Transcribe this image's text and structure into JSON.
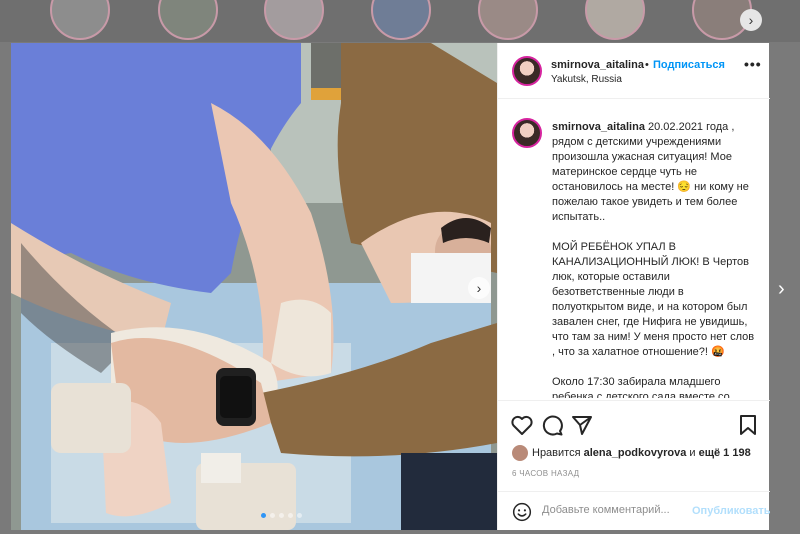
{
  "post": {
    "username": "smirnova_aitalina",
    "separator": "•",
    "follow_label": "Подписаться",
    "location": "Yakutsk, Russia",
    "more_label": "•••",
    "caption_username": "smirnova_aitalina",
    "caption_paragraphs": [
      "20.02.2021 года , рядом с детскими учреждениями произошла ужасная ситуация! Мое материнское сердце чуть не остановилось на месте! 😔 ни кому не пожелаю такое увидеть и тем более испытать..",
      "МОЙ РЕБЁНОК УПАЛ В КАНАЛИЗАЦИОННЫЙ ЛЮК! В Чертов люк, которые оставили безответственные люди в полуоткрытом виде, и на котором был завален снег, где Нифига не увидишь, что там за ним! У меня просто нет слов , что за халатное отношение?! 🤬",
      "Около 17:30 забирала младшего ребенка с детского сада вместе со"
    ],
    "likes_prefix": "Нравится",
    "likes_user": "alena_podkovyrova",
    "likes_and": "и",
    "likes_more": "ещё 1 198",
    "time_ago": "6 ЧАСОВ НАЗАД",
    "comment_placeholder": "Добавьте комментарий...",
    "publish_label": "Опубликовать"
  },
  "navigation": {
    "next_arrow": "›",
    "photo_next_arrow": "›",
    "stories_next_arrow": "›"
  },
  "icons": {
    "like": "heart-icon",
    "comment": "comment-icon",
    "share": "share-icon",
    "save": "bookmark-icon",
    "emoji": "smile-icon"
  },
  "colors": {
    "accent": "#0095f6",
    "publish_disabled": "#b2dffc",
    "carousel_active": "#2f95f6"
  },
  "carousel": {
    "count": 5,
    "active_index": 0
  }
}
